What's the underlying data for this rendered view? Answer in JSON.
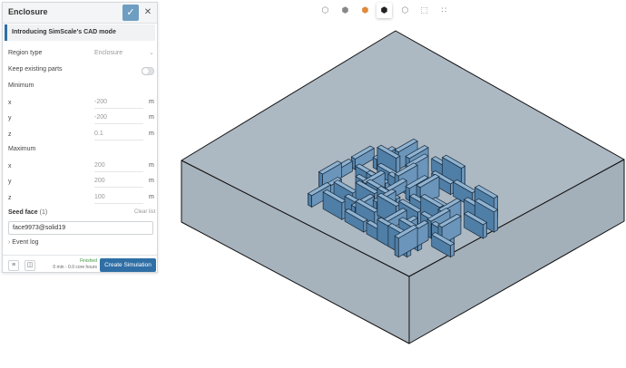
{
  "panel": {
    "title": "Enclosure",
    "banner": "Introducing SimScale's CAD mode",
    "region_type_label": "Region type",
    "region_type_value": "Enclosure",
    "keep_parts_label": "Keep existing parts",
    "minimum_label": "Minimum",
    "maximum_label": "Maximum",
    "min": [
      {
        "axis": "x",
        "value": "-200",
        "unit": "m"
      },
      {
        "axis": "y",
        "value": "-200",
        "unit": "m"
      },
      {
        "axis": "z",
        "value": "0.1",
        "unit": "m"
      }
    ],
    "max": [
      {
        "axis": "x",
        "value": "200",
        "unit": "m"
      },
      {
        "axis": "y",
        "value": "200",
        "unit": "m"
      },
      {
        "axis": "z",
        "value": "100",
        "unit": "m"
      }
    ],
    "seed_face_label": "Seed face",
    "seed_face_count": "(1)",
    "clear_list": "Clear list",
    "seed_face_value": "face9973@solid19",
    "event_log": "Event log",
    "status": "Finished",
    "core_hours": "0 min - 0.0 core hours",
    "create_button": "Create Simulation"
  },
  "toolbar": {
    "icons": [
      "box-outline-icon",
      "box-shaded-icon",
      "box-orange-icon",
      "box-selected-icon",
      "box-dotted-icon",
      "box-select-icon",
      "node-icon"
    ]
  },
  "colors": {
    "accent": "#2f6fa5",
    "box_face": "#abb7c1",
    "box_edge": "#111111",
    "building": "#6f98bd"
  }
}
